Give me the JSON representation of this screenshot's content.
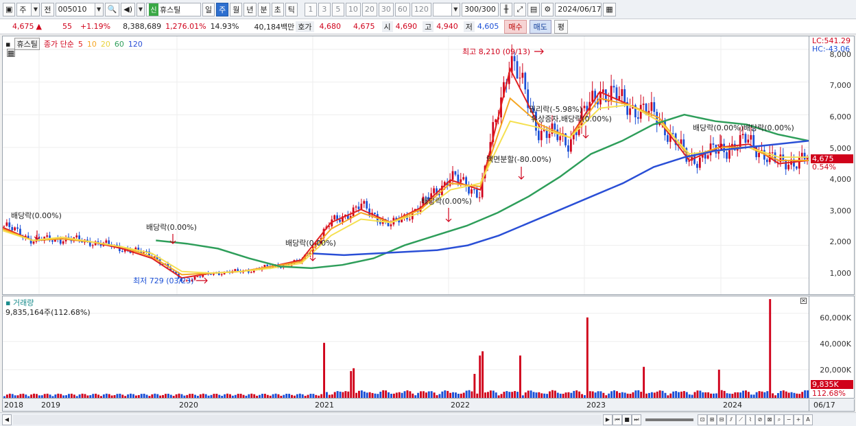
{
  "toolbar": {
    "period_select": "주",
    "compare_label": "전",
    "code": "005010",
    "new_badge": "신",
    "stock_name": "휴스틸",
    "periods": [
      "일",
      "주",
      "월",
      "년",
      "분",
      "초",
      "틱"
    ],
    "selected_period": "주",
    "intervals": [
      "1",
      "3",
      "5",
      "10",
      "20",
      "30",
      "60",
      "120"
    ],
    "count": "300",
    "count_total": "/300",
    "date": "2024/06/17"
  },
  "quote": {
    "price": "4,675",
    "arrow": "▲",
    "change": "55",
    "change_pct": "+1.19%",
    "volume": "8,388,689",
    "volume_pct": "1,276.01%",
    "turnover": "14.93%",
    "amount": "40,184백만",
    "bid_label": "호가",
    "ask_price": "4,680",
    "bid_price": "4,675",
    "open_label": "시",
    "open": "4,690",
    "high_label": "고",
    "high": "4,940",
    "low_label": "저",
    "low": "4,605",
    "buy_label": "매수",
    "sell_label": "매도",
    "flat_label": "평"
  },
  "price_pane": {
    "name_tab": "휴스틸",
    "legend_title": "종가 단순",
    "ma_periods": [
      "5",
      "10",
      "20",
      "60",
      "120"
    ],
    "ma_colors": [
      "#e02020",
      "#f5a623",
      "#f5e050",
      "#2e9e5a",
      "#2a4fd6"
    ],
    "lc_label": "LC:541.29",
    "hc_label": "HC:-43.06",
    "current_price_tag": "4,675",
    "current_pct_tag": "0.54%",
    "y_ticks": [
      "8,000",
      "7,000",
      "6,000",
      "5,000",
      "4,000",
      "3,000",
      "2,000",
      "1,000"
    ],
    "annotations": {
      "high": "최고 8,210 (09/13)",
      "low": "최저 729 (03/23)",
      "div2018": "배당락(0.00%)",
      "div2019": "배당락(0.00%)",
      "div2020": "배당락(0.00%)",
      "div2021": "배당락(0.00%)",
      "split": "액면분할(-80.00%)",
      "rights": "권리락(-5.98%)",
      "rights2": "유상증자,배당락(0.00%)",
      "div2023": "배당락(0.00%)배당락(0.00%)"
    }
  },
  "volume_pane": {
    "title": "거래량",
    "readout": "9,835,164주(112.68%)",
    "y_ticks": [
      "60,000K",
      "40,000K",
      "20,000K"
    ],
    "current_tag": "9,835K",
    "current_pct": "112.68%"
  },
  "xaxis": {
    "labels": [
      "2018",
      "2019",
      "2020",
      "2021",
      "2022",
      "2023",
      "2024"
    ],
    "end_label": "06/17"
  },
  "colors": {
    "up": "#d0021b",
    "down": "#1a4fd6"
  },
  "chart_data": {
    "type": "candlestick",
    "x": [
      "2018",
      "2019",
      "2020",
      "2021",
      "2022",
      "2023",
      "2024"
    ],
    "ylim": [
      500,
      8400
    ],
    "series": [
      {
        "name": "종가",
        "values": [
          2600,
          2150,
          2200,
          2100,
          1900,
          1700,
          900,
          1150,
          1200,
          1350,
          1500,
          2700,
          3200,
          2600,
          3200,
          4100,
          3600,
          7800,
          5500,
          5200,
          6800,
          6300,
          5900,
          4600,
          4900,
          5200,
          4500,
          4675
        ]
      },
      {
        "name": "5",
        "values": [
          2550,
          2150,
          2200,
          2100,
          1900,
          1600,
          1000,
          1150,
          1200,
          1350,
          1550,
          2700,
          3100,
          2700,
          3150,
          4000,
          3700,
          7400,
          5600,
          5300,
          6700,
          6300,
          5800,
          4600,
          5000,
          5100,
          4500,
          4600
        ]
      },
      {
        "name": "10",
        "values": [
          2500,
          2150,
          2200,
          2100,
          1950,
          1650,
          1100,
          1150,
          1200,
          1350,
          1500,
          2500,
          3000,
          2700,
          3100,
          3900,
          3800,
          6500,
          5700,
          5300,
          6500,
          6300,
          5900,
          4700,
          5000,
          5000,
          4600,
          4600
        ]
      },
      {
        "name": "20",
        "values": [
          2450,
          2150,
          2250,
          2100,
          1950,
          1750,
          1200,
          1150,
          1200,
          1300,
          1450,
          2300,
          2800,
          2700,
          3000,
          3700,
          3900,
          5800,
          5600,
          5300,
          6200,
          6300,
          5800,
          4800,
          4900,
          5000,
          4700,
          4700
        ]
      },
      {
        "name": "60",
        "values": [
          2150,
          2050,
          1900,
          1600,
          1350,
          1300,
          1400,
          1600,
          2000,
          2300,
          2600,
          3000,
          3500,
          4100,
          4800,
          5200,
          5700,
          6000,
          5800,
          5700,
          5400,
          5200
        ]
      },
      {
        "name": "120",
        "values": [
          1750,
          1700,
          1750,
          1800,
          1850,
          2000,
          2300,
          2700,
          3100,
          3500,
          3900,
          4400,
          4700,
          4900,
          5000,
          5100,
          5200
        ]
      }
    ],
    "volume_ylim": [
      0,
      70000
    ],
    "volume_unit": "K"
  }
}
